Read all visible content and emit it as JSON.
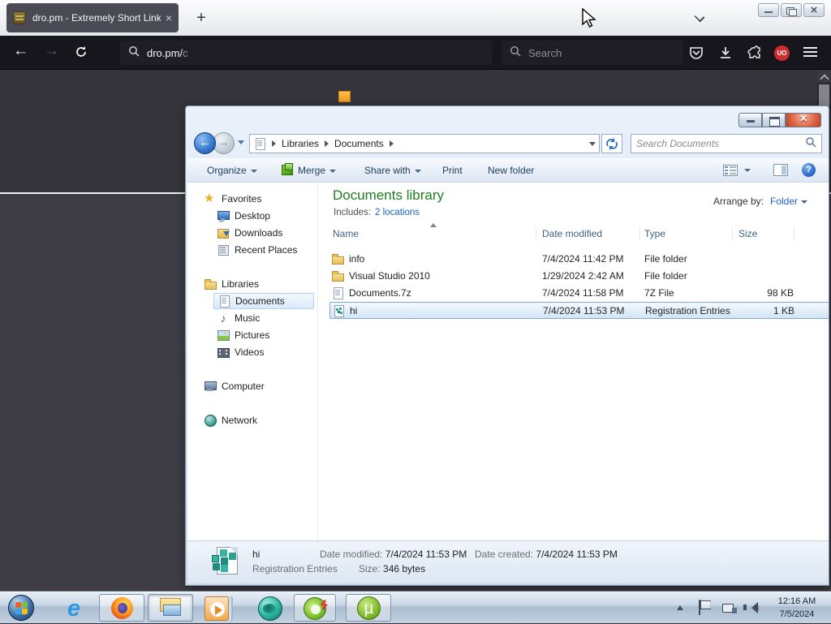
{
  "colors": {
    "library_title_green": "#1d7e1d",
    "link_blue": "#1f62c4",
    "close_button_red": "#d6492f",
    "selection_blue": "#d2e5f7",
    "ublock_red": "#cf2d2d"
  },
  "browser": {
    "tab_title": "dro.pm - Extremely Short Links",
    "tab_close": "×",
    "new_tab": "+",
    "url_domain": "dro.pm/",
    "url_path": "c",
    "search_placeholder": "Search",
    "ublock_badge": "UO"
  },
  "explorer": {
    "breadcrumb": {
      "items": [
        {
          "label": "Libraries"
        },
        {
          "label": "Documents"
        }
      ]
    },
    "search_placeholder": "Search Documents",
    "toolbar": {
      "organize": "Organize",
      "merge": "Merge",
      "share": "Share with",
      "print": "Print",
      "new_folder": "New folder",
      "help": "?"
    },
    "sidebar": {
      "favorites_label": "Favorites",
      "favorites": [
        {
          "label": "Desktop"
        },
        {
          "label": "Downloads"
        },
        {
          "label": "Recent Places"
        }
      ],
      "libraries_label": "Libraries",
      "libraries": [
        {
          "label": "Documents"
        },
        {
          "label": "Music"
        },
        {
          "label": "Pictures"
        },
        {
          "label": "Videos"
        }
      ],
      "computer_label": "Computer",
      "network_label": "Network"
    },
    "library": {
      "title": "Documents library",
      "includes_label": "Includes:",
      "includes_link": "2 locations",
      "arrange_label": "Arrange by:",
      "arrange_value": "Folder"
    },
    "columns": {
      "name": "Name",
      "date": "Date modified",
      "type": "Type",
      "size": "Size"
    },
    "files": [
      {
        "name": "info",
        "date": "7/4/2024 11:42 PM",
        "type": "File folder",
        "size": ""
      },
      {
        "name": "Visual Studio 2010",
        "date": "1/29/2024 2:42 AM",
        "type": "File folder",
        "size": ""
      },
      {
        "name": "Documents.7z",
        "date": "7/4/2024 11:58 PM",
        "type": "7Z File",
        "size": "98 KB"
      },
      {
        "name": "hi",
        "date": "7/4/2024 11:53 PM",
        "type": "Registration Entries",
        "size": "1 KB"
      }
    ],
    "details": {
      "name": "hi",
      "type": "Registration Entries",
      "modified_label": "Date modified:",
      "modified": "7/4/2024 11:53 PM",
      "size_label": "Size:",
      "size": "346 bytes",
      "created_label": "Date created:",
      "created": "7/4/2024 11:53 PM"
    }
  },
  "taskbar": {
    "time": "12:16 AM",
    "date": "7/5/2024"
  }
}
